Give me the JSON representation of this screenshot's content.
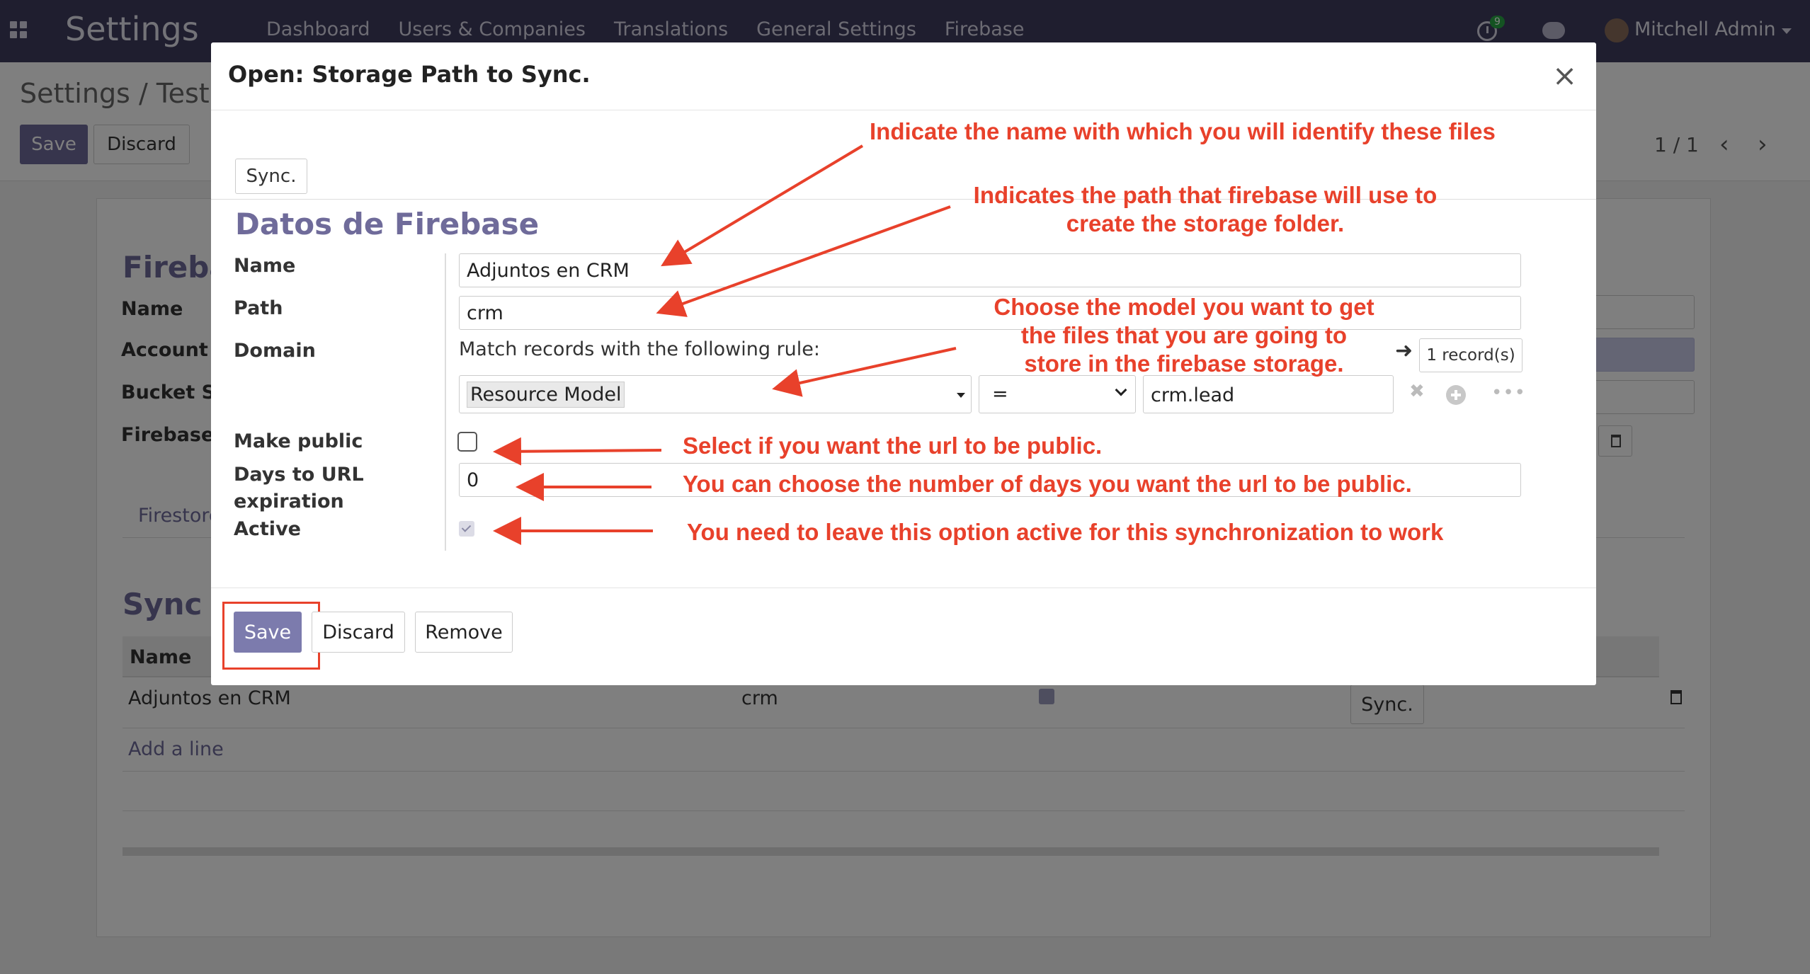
{
  "navbar": {
    "app_title": "Settings",
    "menu": [
      "Dashboard",
      "Users & Companies",
      "Translations",
      "General Settings",
      "Firebase"
    ],
    "activity_count": "9",
    "user_name": "Mitchell Admin"
  },
  "background": {
    "breadcrumb": "Settings / Test",
    "save_label": "Save",
    "discard_label": "Discard",
    "pager": "1 / 1",
    "sheet_title": "Fireba",
    "labels": [
      "Name",
      "Account",
      "Bucket Sto",
      "Firebase F"
    ],
    "tab_label": "Firestore",
    "sync_title": "Sync r",
    "list_header_name": "Name",
    "row": {
      "name": "Adjuntos en CRM",
      "path": "crm",
      "sync_label": "Sync."
    },
    "add_line": "Add a line"
  },
  "modal": {
    "title": "Open: Storage Path to Sync.",
    "sync_button": "Sync.",
    "section_title": "Datos de Firebase",
    "fields": {
      "name_label": "Name",
      "name_value": "Adjuntos en CRM",
      "path_label": "Path",
      "path_value": "crm",
      "domain_label": "Domain",
      "domain_text": "Match records with the following rule:",
      "records_label": "1 record(s)",
      "domain_field": "Resource Model",
      "domain_operator": "=",
      "domain_value": "crm.lead",
      "make_public_label": "Make public",
      "make_public": false,
      "days_label": "Days to URL expiration",
      "days_value": "0",
      "active_label": "Active",
      "active": true
    },
    "footer": {
      "save": "Save",
      "discard": "Discard",
      "remove": "Remove"
    }
  },
  "annotations": {
    "name_note": "Indicate the name with which you will identify these files",
    "path_note_1": "Indicates the path that firebase will use to",
    "path_note_2": "create the storage folder.",
    "model_note_1": "Choose the model you want to get",
    "model_note_2": "the files that you are going to",
    "model_note_3": "store in the firebase storage.",
    "public_note": "Select if you want the url to be public.",
    "days_note": "You can choose the number of days you want the url to be public.",
    "active_note": "You need to leave this option active for this synchronization to work",
    "accent_color": "#e8412b"
  }
}
